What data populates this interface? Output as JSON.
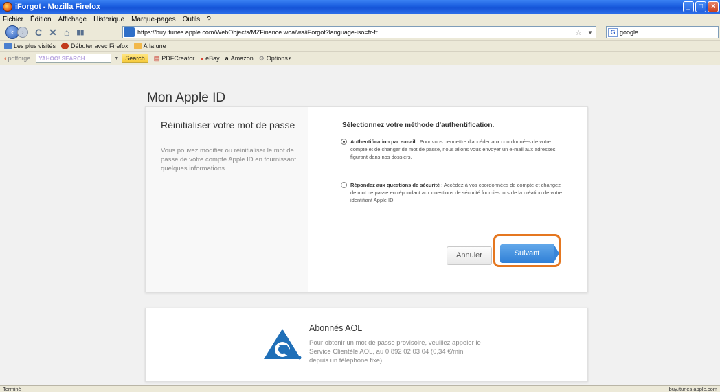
{
  "window": {
    "title": "iForgot - Mozilla Firefox"
  },
  "menu": [
    "Fichier",
    "Édition",
    "Affichage",
    "Historique",
    "Marque-pages",
    "Outils",
    "?"
  ],
  "nav": {
    "url": "https://buy.itunes.apple.com/WebObjects/MZFinance.woa/wa/iForgot?language-iso=fr-fr",
    "search_value": "google"
  },
  "bookmarks": [
    "Les plus visités",
    "Débuter avec Firefox",
    "À la une"
  ],
  "toolbar": {
    "brand": "pdfforge",
    "search_brand": "YAHOO! SEARCH",
    "search_button": "Search",
    "items": [
      "PDFCreator",
      "eBay",
      "Amazon",
      "Options"
    ]
  },
  "page": {
    "title": "Mon Apple ID",
    "left_heading": "Réinitialiser votre mot de passe",
    "left_text": "Vous pouvez modifier ou réinitialiser le mot de passe de votre compte Apple ID en fournissant quelques informations.",
    "method_heading": "Sélectionnez votre méthode d'authentification.",
    "option1_title": "Authentification par e-mail",
    "option1_text": " : Pour vous permettre d'accéder aux coordonnées de votre compte et de changer de mot de passe, nous allons vous envoyer un e-mail aux adresses figurant dans nos dossiers.",
    "option2_title": "Répondez aux questions de sécurité",
    "option2_text": " : Accédez à vos coordonnées de compte et changez de mot de passe en répondant aux questions de sécurité fournies lors de la création de votre identifiant Apple ID.",
    "cancel_label": "Annuler",
    "next_label": "Suivant",
    "aol_heading": "Abonnés AOL",
    "aol_text": "Pour obtenir un mot de passe provisoire, veuillez appeler le Service Clientèle AOL, au 0 892 02 03 04 (0,34 €/min depuis un téléphone fixe)."
  },
  "status": {
    "left": "Terminé",
    "right": "buy.itunes.apple.com"
  },
  "colors": {
    "highlight": "#e57720",
    "primary_button": "#2f7fd6"
  }
}
